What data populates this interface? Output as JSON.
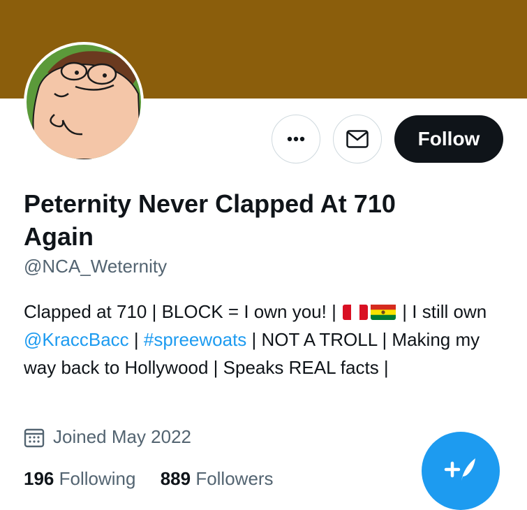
{
  "profile": {
    "banner_color": "#8b5e0c",
    "avatar_alt": "profile avatar",
    "display_name": "Peternity Never Clapped At 710 Again",
    "handle": "@NCA_Weternity",
    "bio": {
      "part1": "Clapped at 710 | BLOCK = I own you! |",
      "flag1": "peru-flag",
      "flag2": "bolivia-flag",
      "part2": "| I still own",
      "mention": "@KraccBacc",
      "sep1": "|",
      "hashtag": "#spreewoats",
      "part3": "| NOT A TROLL | Making my way back to Hollywood | Speaks REAL facts |"
    },
    "joined": "Joined May 2022"
  },
  "actions": {
    "more_icon": "more-horizontal-icon",
    "message_icon": "envelope-icon",
    "follow_label": "Follow"
  },
  "stats": {
    "following_count": "196",
    "following_label": "Following",
    "followers_count": "889",
    "followers_label": "Followers"
  },
  "compose": {
    "icon": "compose-tweet-icon"
  },
  "colors": {
    "accent": "#1d9bf0",
    "text": "#0f1419",
    "muted": "#536471"
  }
}
